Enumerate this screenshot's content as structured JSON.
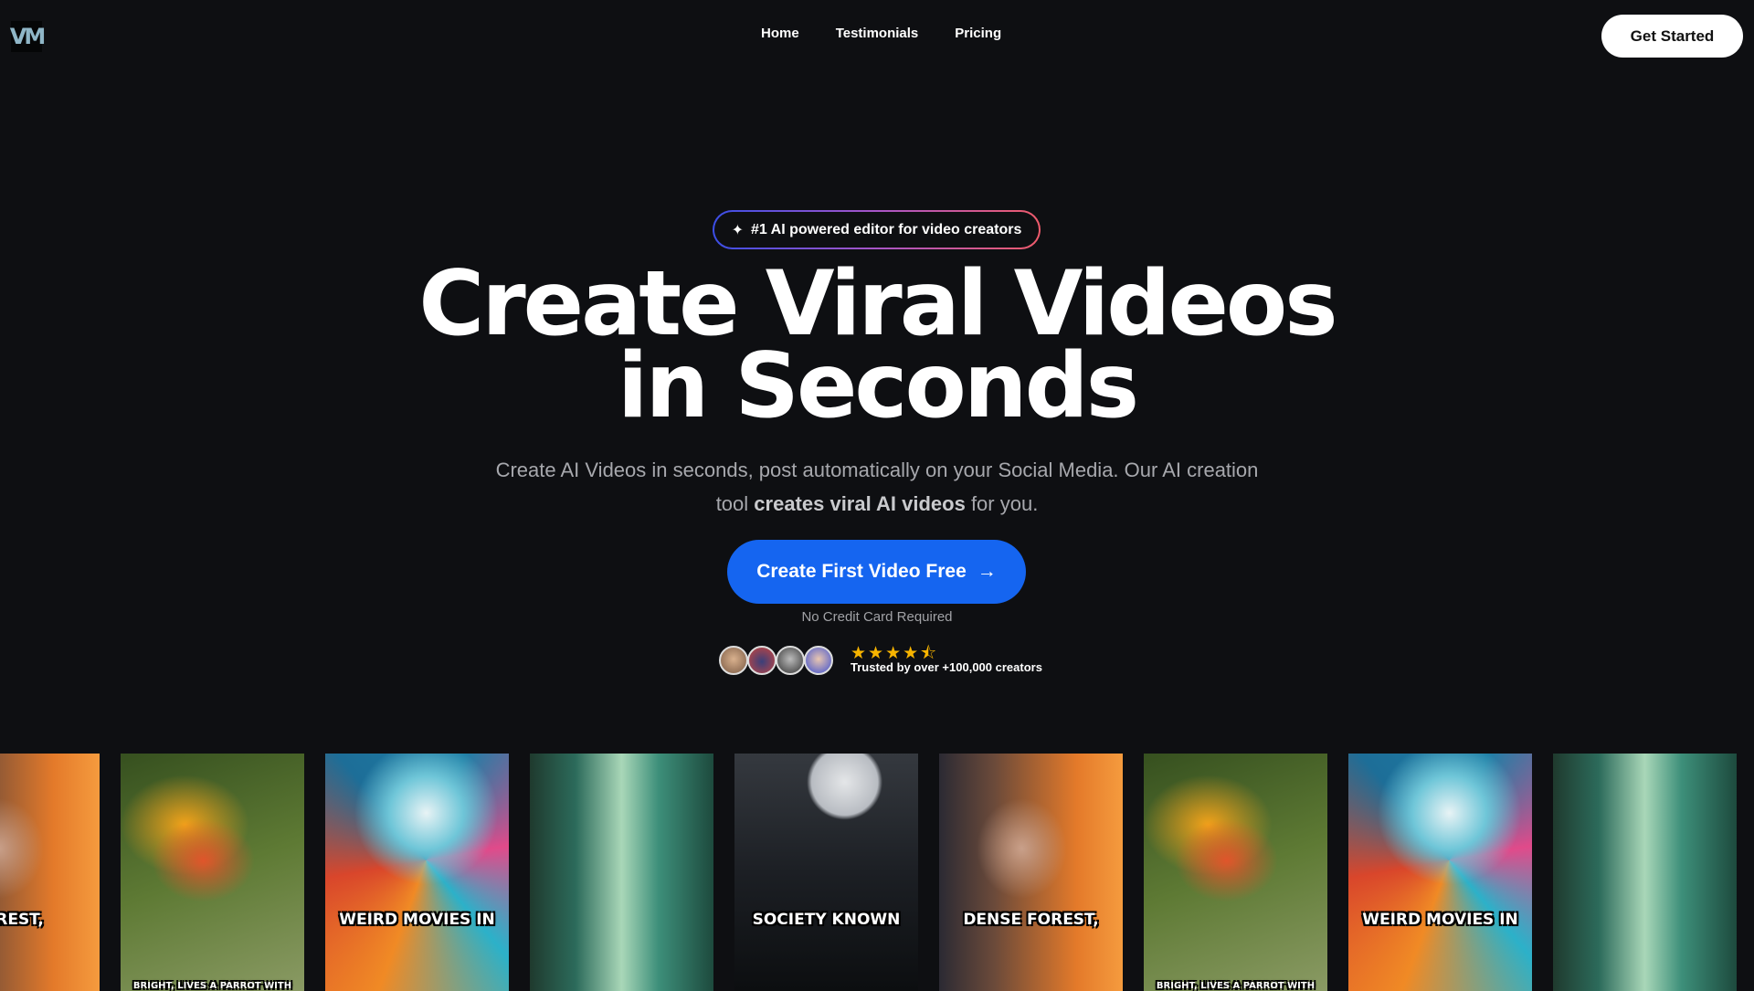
{
  "nav": {
    "logo": "VM",
    "links": [
      "Home",
      "Testimonials",
      "Pricing"
    ],
    "cta": "Get Started"
  },
  "hero": {
    "badge": "#1 AI powered editor for video creators",
    "title_line1": "Create Viral Videos",
    "title_line2": "in Seconds",
    "subtitle_a": "Create AI Videos in seconds, post automatically on your Social Media. Our AI creation tool ",
    "subtitle_bold": "creates viral AI videos",
    "subtitle_b": " for you.",
    "cta": "Create First Video Free",
    "note": "No Credit Card Required",
    "rating": 4.5,
    "stars": "★★★★⯪",
    "trusted": "Trusted by over +100,000 creators"
  },
  "colors": {
    "accent": "#1565f0",
    "star": "#f7b400",
    "background": "#0e0f12"
  },
  "videos": [
    {
      "theme": "woman",
      "caption": "FOREST,"
    },
    {
      "theme": "parrot",
      "caption_bottom": "BRIGHT, LIVES A PARROT WITH"
    },
    {
      "theme": "swirl",
      "caption": "WEIRD MOVIES IN"
    },
    {
      "theme": "forest"
    },
    {
      "theme": "moon",
      "caption": "SOCIETY KNOWN"
    },
    {
      "theme": "woman",
      "caption": "DENSE FOREST,"
    },
    {
      "theme": "parrot",
      "caption_bottom": "BRIGHT, LIVES A PARROT WITH"
    },
    {
      "theme": "swirl",
      "caption": "WEIRD MOVIES IN"
    },
    {
      "theme": "forest"
    }
  ]
}
